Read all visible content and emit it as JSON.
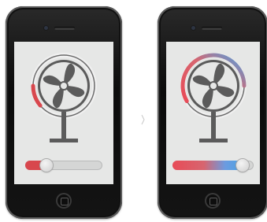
{
  "phones": [
    {
      "name": "left",
      "icon": "fan-icon",
      "dial_level": 0.2,
      "slider_level": 0.28,
      "accent_colors": [
        "#d8474d"
      ]
    },
    {
      "name": "right",
      "icon": "fan-icon",
      "dial_level": 0.78,
      "slider_level": 0.86,
      "accent_colors": [
        "#e84b57",
        "#4aa3e5"
      ]
    }
  ],
  "colors": {
    "fan": "#5b5b5b",
    "screen": "#e6e7e6",
    "dial_track": "#f0f0f0"
  }
}
